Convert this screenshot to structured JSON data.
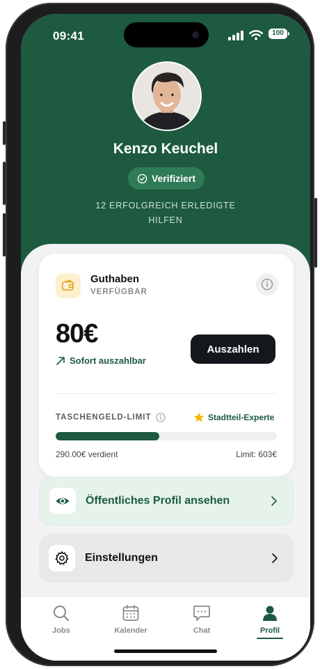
{
  "status_bar": {
    "time": "09:41",
    "battery": "100"
  },
  "profile": {
    "name": "Kenzo Keuchel",
    "verified_label": "Verifiziert",
    "helps_text": "12 ERFOLGREICH ERLEDIGTE HILFEN"
  },
  "balance_card": {
    "title": "Guthaben",
    "subtitle": "VERFÜGBAR",
    "amount": "80€",
    "payout_note": "Sofort auszahlbar",
    "payout_button": "Auszahlen",
    "limit_label": "TASCHENGELD-LIMIT",
    "badge": "Stadtteil-Experte",
    "progress_fraction": 0.47,
    "earned": "290.00€ verdient",
    "limit": "Limit: 603€"
  },
  "menu": {
    "public_profile": "Öffentliches Profil ansehen",
    "settings": "Einstellungen"
  },
  "tabs": [
    {
      "label": "Jobs",
      "icon": "search-icon"
    },
    {
      "label": "Kalender",
      "icon": "calendar-icon"
    },
    {
      "label": "Chat",
      "icon": "chat-icon"
    },
    {
      "label": "Profil",
      "icon": "person-icon"
    }
  ],
  "colors": {
    "brand": "#1d5a40",
    "hero": "#1d5a40",
    "dark_button": "#14171c",
    "wallet_bg": "#fdf0cf"
  }
}
